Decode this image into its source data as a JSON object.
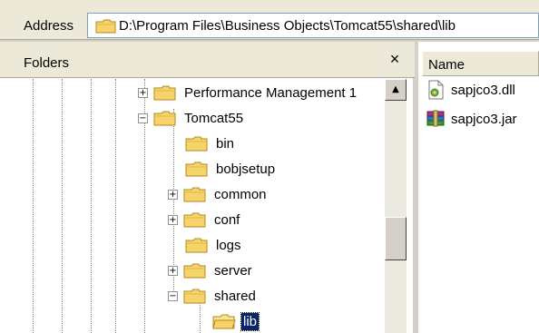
{
  "address": {
    "label": "Address",
    "path": "D:\\Program Files\\Business Objects\\Tomcat55\\shared\\lib"
  },
  "folders_pane": {
    "title": "Folders",
    "close": "×"
  },
  "tree": [
    {
      "label": "Performance Management 1",
      "expander": "+"
    },
    {
      "label": "Tomcat55",
      "expander": "−"
    },
    {
      "label": "bin",
      "expander": ""
    },
    {
      "label": "bobjsetup",
      "expander": ""
    },
    {
      "label": "common",
      "expander": "+"
    },
    {
      "label": "conf",
      "expander": "+"
    },
    {
      "label": "logs",
      "expander": ""
    },
    {
      "label": "server",
      "expander": "+"
    },
    {
      "label": "shared",
      "expander": "−"
    },
    {
      "label": "lib",
      "expander": "",
      "selected": true
    }
  ],
  "scrollbar": {
    "up_arrow": "▲"
  },
  "files_pane": {
    "name_header": "Name",
    "files": [
      {
        "name": "sapjco3.dll",
        "icon": "dll-file-icon"
      },
      {
        "name": "sapjco3.jar",
        "icon": "archive-jar-icon"
      }
    ]
  },
  "colors": {
    "selection": "#0a246a",
    "folder": "#f6d46b"
  }
}
